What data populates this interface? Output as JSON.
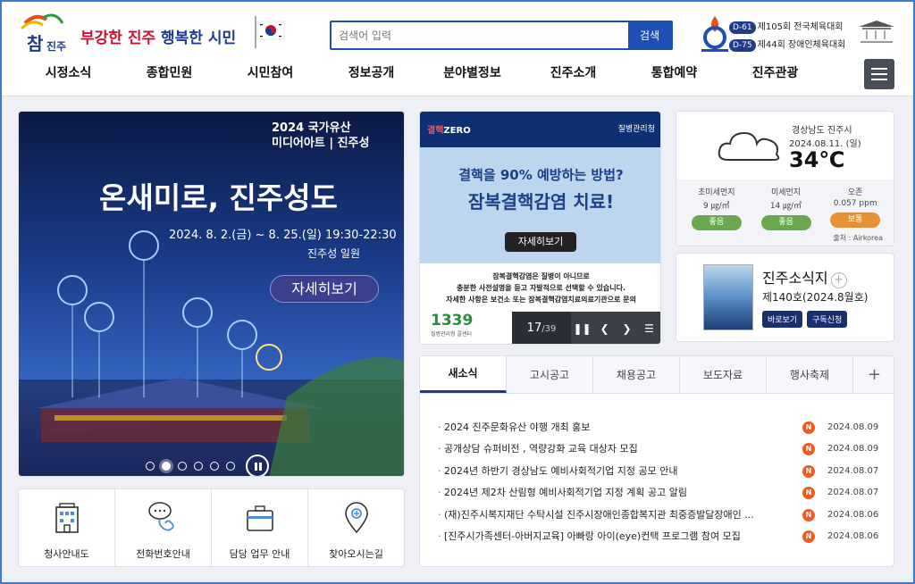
{
  "header": {
    "logo_text": "참진주",
    "slogan_red": "부강한 진주",
    "slogan_blue": "행복한 시민",
    "search_placeholder": "검색어 입력",
    "search_button": "검색",
    "dday": [
      {
        "tag": "D-61",
        "label": "제105회 전국체육대회"
      },
      {
        "tag": "D-75",
        "label": "제44회 장애인체육대회"
      }
    ]
  },
  "nav": [
    "시정소식",
    "종합민원",
    "시민참여",
    "정보공개",
    "분야별정보",
    "진주소개",
    "통합예약",
    "진주관광"
  ],
  "hero": {
    "brand_line1": "2024 국가유산",
    "brand_line2": "미디어아트 | 진주성",
    "title": "온새미로, 진주성도",
    "date": "2024. 8. 2.(금) ~ 8. 25.(일) 19:30-22:30",
    "location": "진주성 일원",
    "button": "자세히보기",
    "slide_count": 6,
    "active_slide": 1
  },
  "banner": {
    "top_left_a": "결핵",
    "top_left_b": "ZERO",
    "top_right": "질병관리청",
    "headline1": "결핵을 90% 예방하는 방법?",
    "headline2": "잠복결핵감염 치료!",
    "button": "자세히보기",
    "text1": "잠복결핵감염은 질병이 아니므로",
    "text2": "충분한 사전설명을 듣고 자발적으로 선택할 수 있습니다.",
    "text3": "자세한 사항은 보건소 또는 잠복결핵감염치료의료기관으로 문의",
    "hotline": "1339",
    "hotline_sub": "질병관리청 콜센터",
    "current": "17",
    "total": "/39"
  },
  "weather": {
    "location": "경상남도 진주시",
    "date": "2024.08.11. (일)",
    "temp": "34℃",
    "air": [
      {
        "name": "초미세먼지",
        "value": "9 ㎍/㎥",
        "status": "좋음",
        "color": "#6aa84f"
      },
      {
        "name": "미세먼지",
        "value": "14 ㎍/㎥",
        "status": "좋음",
        "color": "#6aa84f"
      },
      {
        "name": "오존",
        "value": "0.057 ppm",
        "status": "보통",
        "color": "#e69138"
      }
    ],
    "source": "출처 : Airkorea"
  },
  "newsletter": {
    "title": "진주소식지",
    "issue": "제140호(2024.8월호)",
    "btn_view": "바로보기",
    "btn_sub": "구독신청"
  },
  "board": {
    "tabs": [
      "새소식",
      "고시공고",
      "채용공고",
      "보도자료",
      "행사축제"
    ],
    "items": [
      {
        "title": "2024 진주문화유산 야행 개최 홍보",
        "date": "2024.08.09"
      },
      {
        "title": "공개상담 슈퍼비전 , 역량강화 교육 대상자 모집",
        "date": "2024.08.09"
      },
      {
        "title": "2024년 하반기 경상남도 예비사회적기업 지정 공모 안내",
        "date": "2024.08.07"
      },
      {
        "title": "2024년 제2차 산림형 예비사회적기업 지정 계획 공고 알림",
        "date": "2024.08.07"
      },
      {
        "title": "(재)진주시복지재단 수탁시설 진주시장애인종합복지관 최중증발달장애인 ...",
        "date": "2024.08.06"
      },
      {
        "title": "[진주시가족센터-아버지교육] 아빠랑 아이(eye)컨택 프로그램 참여 모집",
        "date": "2024.08.06"
      }
    ],
    "new_badge": "N"
  },
  "quick": [
    "청사안내도",
    "전화번호안내",
    "담당 업무 안내",
    "찾아오시는길"
  ]
}
